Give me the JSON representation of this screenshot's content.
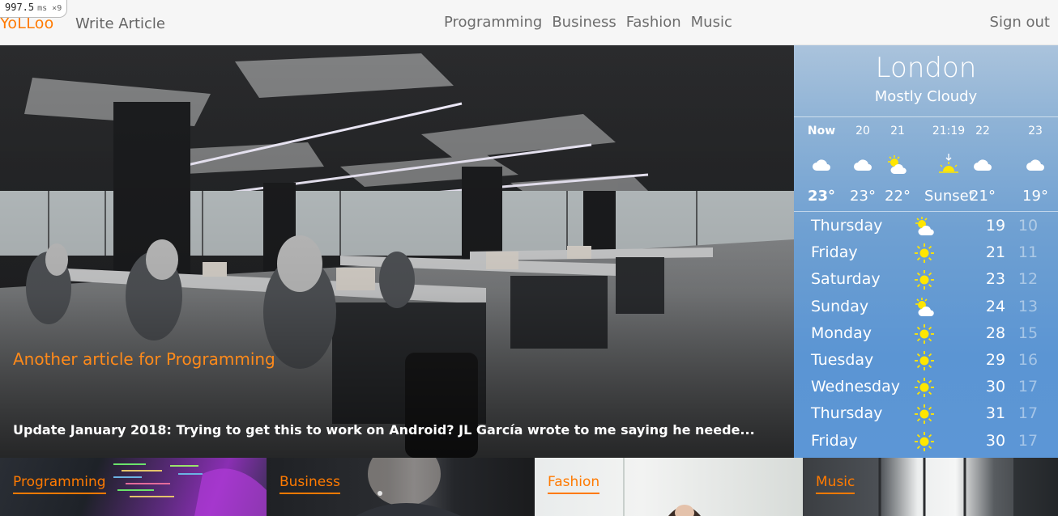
{
  "perf": {
    "value": "997.5",
    "unit": "ms",
    "mult": "×9"
  },
  "header": {
    "logo": "YoLLoo",
    "write_article": "Write Article",
    "nav": [
      "Programming",
      "Business",
      "Fashion",
      "Music"
    ],
    "sign_out": "Sign out"
  },
  "hero": {
    "title": "Another article for Programming",
    "excerpt": "Update January 2018: Trying to get this to work on Android? JL García wrote to me saying he neede..."
  },
  "weather": {
    "city": "London",
    "condition": "Mostly Cloudy",
    "hourly": [
      {
        "time": "Now",
        "icon": "cloud-icon",
        "temp": "23°"
      },
      {
        "time": "20",
        "icon": "cloud-icon",
        "temp": "23°"
      },
      {
        "time": "21",
        "icon": "partly-sunny-icon",
        "temp": "22°"
      },
      {
        "time": "21:19",
        "icon": "sunset-icon",
        "temp": "Sunset"
      },
      {
        "time": "22",
        "icon": "cloud-icon",
        "temp": "21°"
      },
      {
        "time": "23",
        "icon": "cloud-icon",
        "temp": "19°"
      }
    ],
    "daily": [
      {
        "day": "Thursday",
        "icon": "partly-sunny-icon",
        "high": "19",
        "low": "10"
      },
      {
        "day": "Friday",
        "icon": "sun-icon",
        "high": "21",
        "low": "11"
      },
      {
        "day": "Saturday",
        "icon": "sun-icon",
        "high": "23",
        "low": "12"
      },
      {
        "day": "Sunday",
        "icon": "partly-sunny-icon",
        "high": "24",
        "low": "13"
      },
      {
        "day": "Monday",
        "icon": "sun-icon",
        "high": "28",
        "low": "15"
      },
      {
        "day": "Tuesday",
        "icon": "sun-icon",
        "high": "29",
        "low": "16"
      },
      {
        "day": "Wednesday",
        "icon": "sun-icon",
        "high": "30",
        "low": "17"
      },
      {
        "day": "Thursday",
        "icon": "sun-icon",
        "high": "31",
        "low": "17"
      },
      {
        "day": "Friday",
        "icon": "sun-icon",
        "high": "30",
        "low": "17"
      }
    ]
  },
  "categories": [
    {
      "label": "Programming"
    },
    {
      "label": "Business"
    },
    {
      "label": "Fashion"
    },
    {
      "label": "Music"
    }
  ],
  "colors": {
    "accent": "#ff7a00",
    "sun": "#ffe600"
  }
}
